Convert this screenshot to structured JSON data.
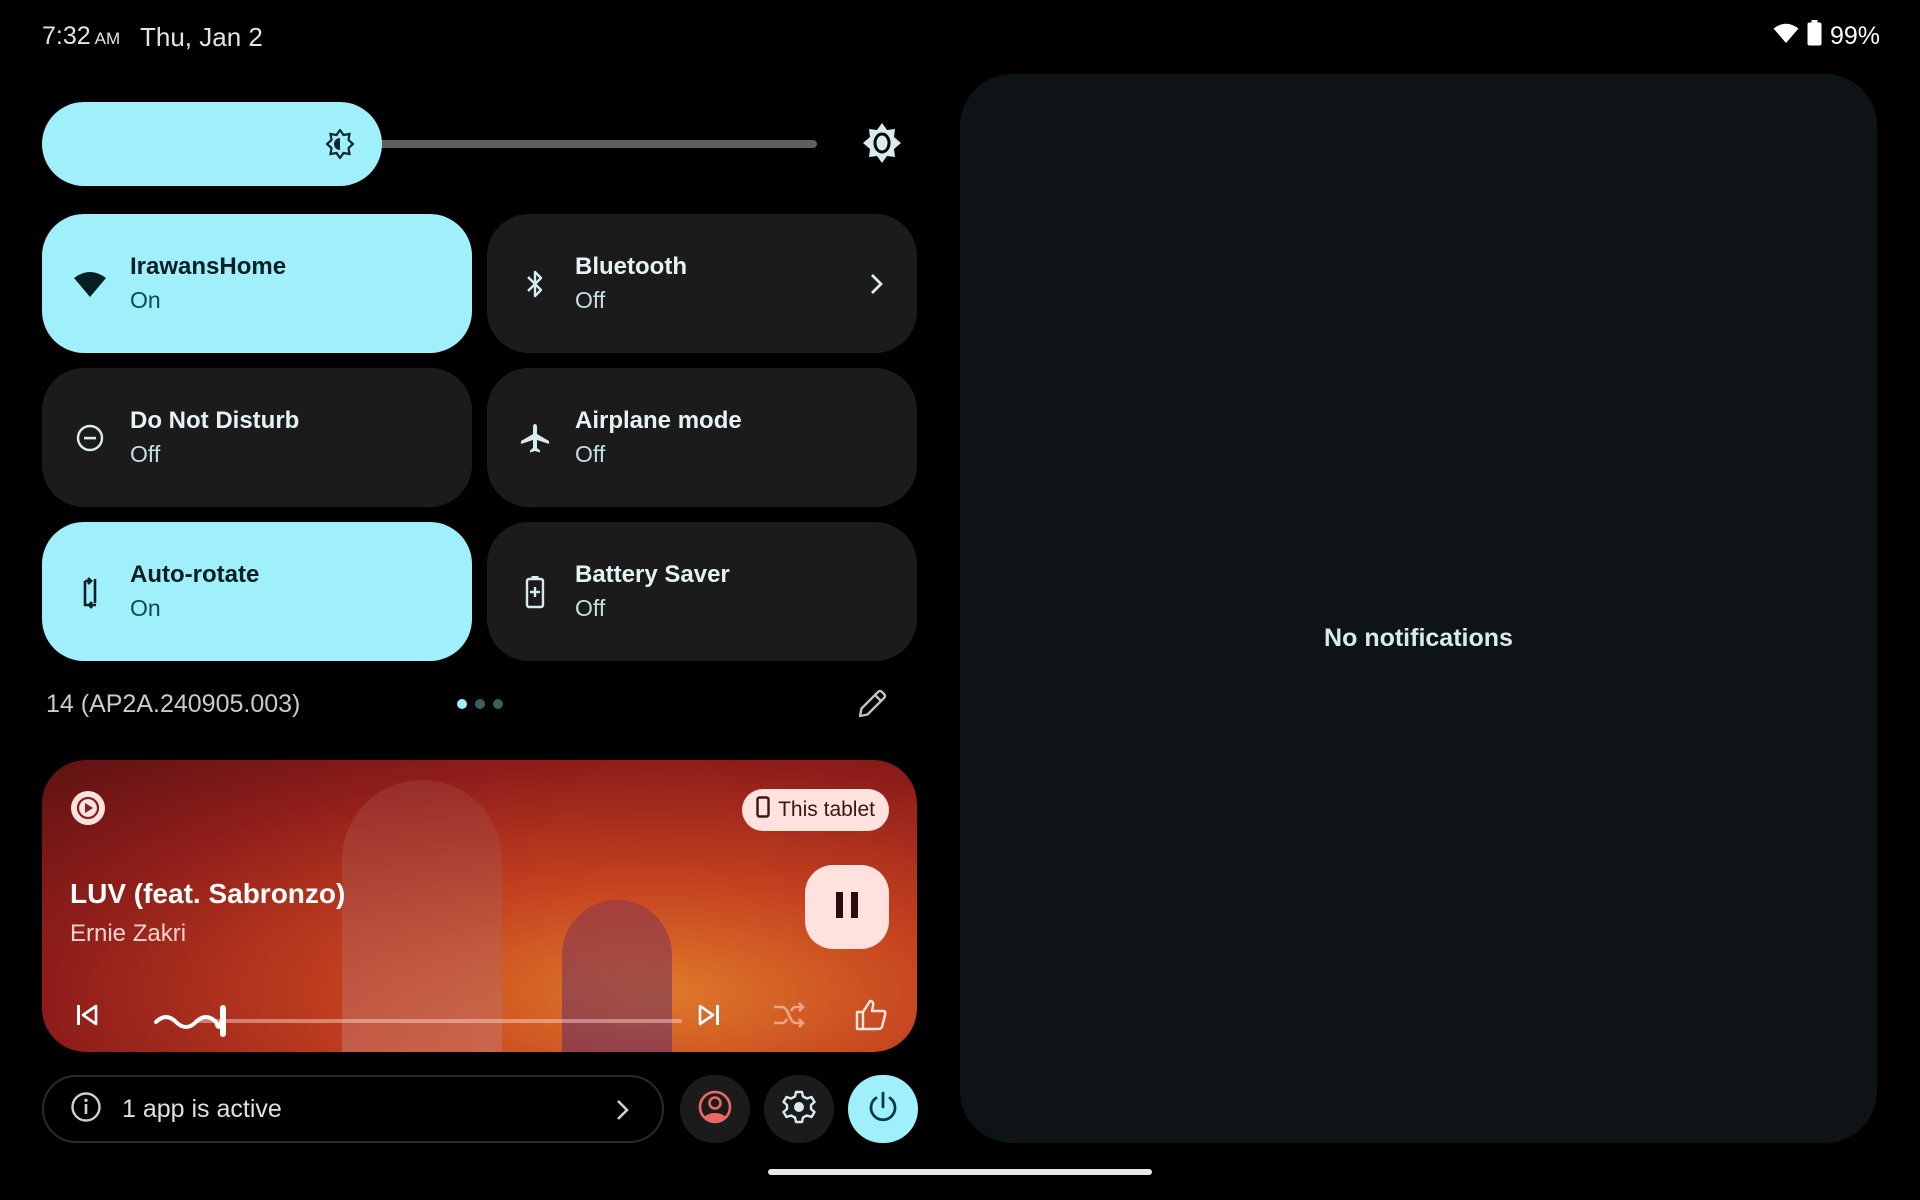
{
  "status_bar": {
    "time": "7:32",
    "am_pm": "AM",
    "date": "Thu, Jan 2",
    "icons": [
      "wifi-icon",
      "battery-icon"
    ],
    "battery_percent": "99%"
  },
  "brightness": {
    "level": 0.37,
    "auto_brightness_icon": "brightness-auto-icon"
  },
  "tiles": [
    {
      "label": "IrawansHome",
      "state": "On",
      "icon": "wifi-icon",
      "active": true,
      "has_chevron": false
    },
    {
      "label": "Bluetooth",
      "state": "Off",
      "icon": "bluetooth-icon",
      "active": false,
      "has_chevron": true
    },
    {
      "label": "Do Not Disturb",
      "state": "Off",
      "icon": "do-not-disturb-icon",
      "active": false,
      "has_chevron": false
    },
    {
      "label": "Airplane mode",
      "state": "Off",
      "icon": "airplane-icon",
      "active": false,
      "has_chevron": false
    },
    {
      "label": "Auto-rotate",
      "state": "On",
      "icon": "auto-rotate-icon",
      "active": true,
      "has_chevron": false
    },
    {
      "label": "Battery Saver",
      "state": "Off",
      "icon": "battery-saver-icon",
      "active": false,
      "has_chevron": false
    }
  ],
  "build_number": "14 (AP2A.240905.003)",
  "pager": {
    "pages": 3,
    "current": 1
  },
  "media": {
    "title": "LUV (feat. Sabronzo)",
    "artist": "Ernie Zakri",
    "output_device": "This tablet",
    "progress": 0.13,
    "state": "playing",
    "colors": {
      "chip": "#ffe1de",
      "chip_text": "#3b1612"
    }
  },
  "footer": {
    "active_apps_label": "1 app is active",
    "buttons": [
      "user-icon",
      "settings-icon",
      "power-icon"
    ]
  },
  "notifications": {
    "empty_label": "No notifications"
  },
  "colors": {
    "accent": "#a0f0fb",
    "tile_off": "#1b1b1b",
    "panel": "#0e1315",
    "user_icon": "#e86a64"
  }
}
